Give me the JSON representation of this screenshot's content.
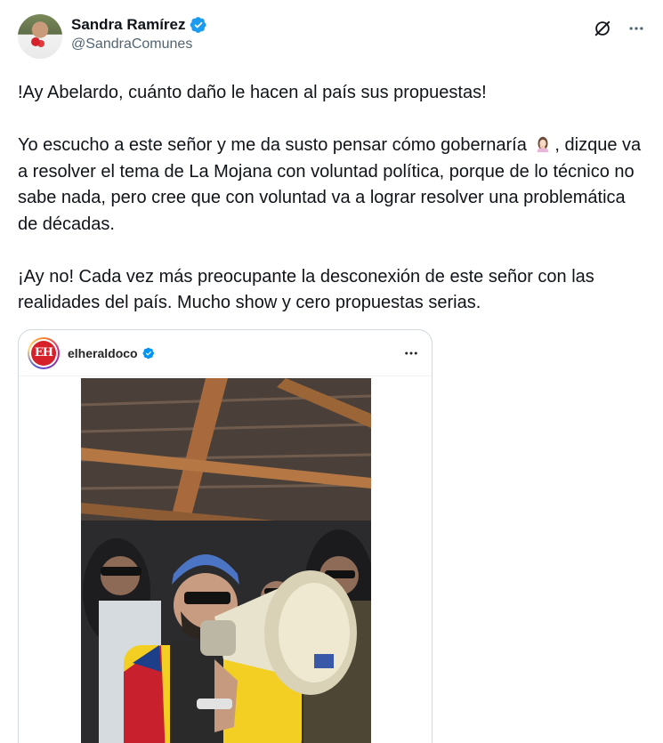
{
  "header": {
    "display_name": "Sandra Ramírez",
    "handle": "@SandraComunes"
  },
  "tweet": {
    "paragraph1": "!Ay Abelardo, cuánto daño le hacen al país sus propuestas!",
    "paragraph2_before_emoji": "Yo escucho a este señor y me da susto pensar cómo gobernaría",
    "paragraph2_after_emoji": ", dizque va a resolver el tema de La Mojana con voluntad política, porque de lo técnico no sabe nada, pero cree que con voluntad va a lograr resolver una problemática de décadas.",
    "paragraph3": "¡Ay no! Cada vez más preocupante la desconexión de este señor con las realidades del país. Mucho show y cero propuestas serias."
  },
  "embed": {
    "account_name": "elheraldoco",
    "logo_text": "EH"
  },
  "colors": {
    "verified_blue": "#1d9bf0",
    "text_primary": "#0f1419",
    "text_secondary": "#536471",
    "border": "#cfd9de",
    "brand_red": "#d6202a"
  },
  "icons": {
    "verified": "verified-badge-icon",
    "grok": "grok-icon",
    "more": "more-icon",
    "emoji": "woman-facepalming-emoji"
  }
}
